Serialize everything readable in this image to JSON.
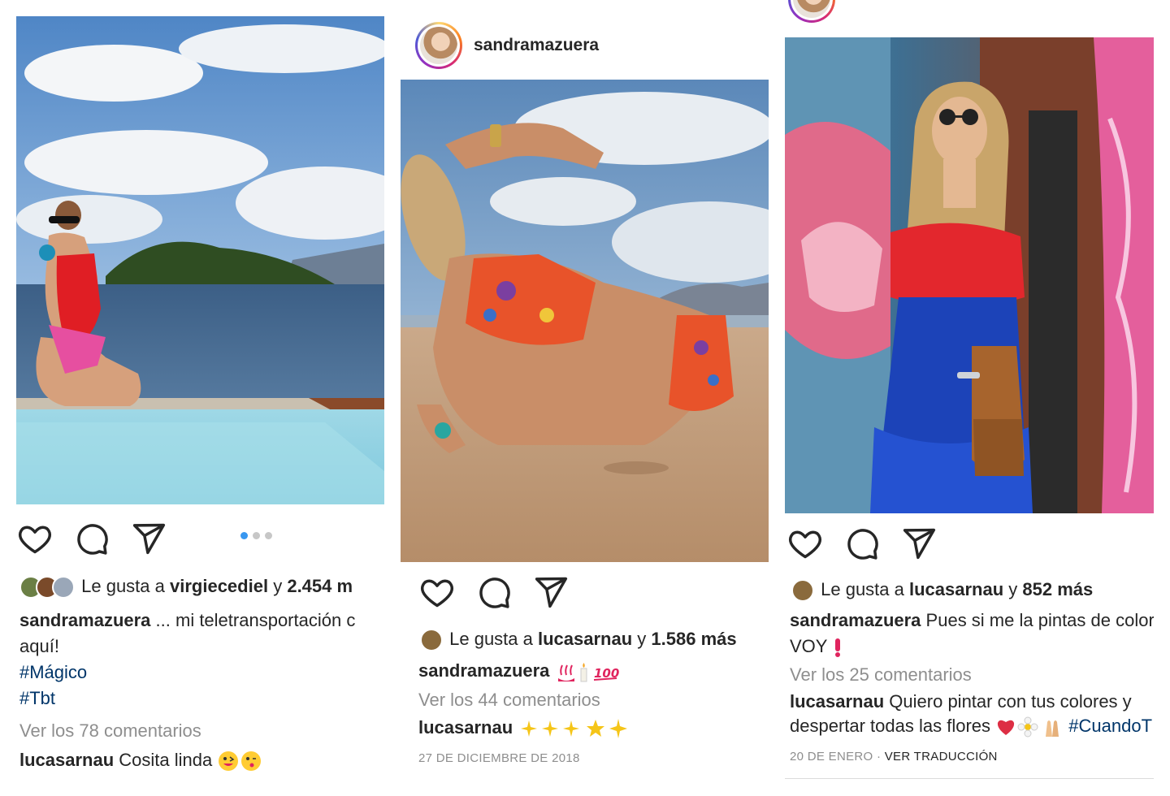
{
  "posts": [
    {
      "username": "sandramazuera",
      "likes": {
        "prefix": "Le gusta a",
        "user": "virgiecediel",
        "connector": "y",
        "count": "2.454 m"
      },
      "caption": {
        "user": "sandramazuera",
        "text": "... mi teletransportación c",
        "line2": "aquí!",
        "tags": [
          "#Mágico",
          "#Tbt"
        ]
      },
      "view_comments": "Ver los 78 comentarios",
      "comment": {
        "user": "lucasarnau",
        "text": "Cosita linda"
      },
      "carousel": {
        "count": 3,
        "active": 0
      }
    },
    {
      "username": "sandramazuera",
      "likes": {
        "prefix": "Le gusta a",
        "user": "lucasarnau",
        "connector": "y",
        "count": "1.586 más"
      },
      "caption": {
        "user": "sandramazuera",
        "text": ""
      },
      "view_comments": "Ver los 44 comentarios",
      "comment": {
        "user": "lucasarnau",
        "text": ""
      },
      "date": "27 DE DICIEMBRE DE 2018"
    },
    {
      "likes": {
        "prefix": "Le gusta a",
        "user": "lucasarnau",
        "connector": "y",
        "count": "852 más"
      },
      "caption": {
        "user": "sandramazuera",
        "text": "Pues si me la pintas de color",
        "line2": "VOY"
      },
      "view_comments": "Ver los 25 comentarios",
      "comment": {
        "user": "lucasarnau",
        "text": "Quiero pintar con tus colores y",
        "line2": "despertar todas las flores",
        "tag": "#CuandoT"
      },
      "date": "20 DE ENERO",
      "translate": "VER TRADUCCIÓN"
    }
  ],
  "icons": [
    "heart-icon",
    "comment-icon",
    "share-icon"
  ],
  "colors": {
    "text": "#262626",
    "muted": "#8e8e8e",
    "hashtag": "#003569",
    "active_dot": "#3897f0"
  }
}
